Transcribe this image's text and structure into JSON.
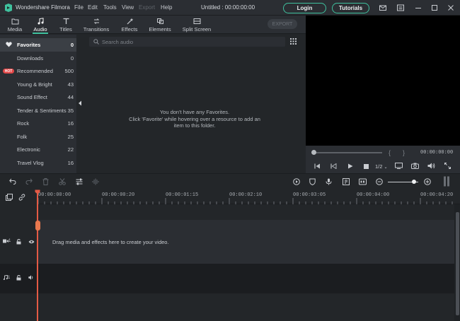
{
  "titlebar": {
    "app_name": "Wondershare Filmora",
    "menu": [
      "File",
      "Edit",
      "Tools",
      "View",
      "Export",
      "Help"
    ],
    "document_title": "Untitled : 00:00:00:00",
    "login_label": "Login",
    "tutorials_label": "Tutorials",
    "accent_color": "#3fc19e"
  },
  "tabs": [
    {
      "label": "Media",
      "icon": "folder-icon"
    },
    {
      "label": "Audio",
      "icon": "music-note-icon"
    },
    {
      "label": "Titles",
      "icon": "text-t-icon"
    },
    {
      "label": "Transitions",
      "icon": "transition-icon"
    },
    {
      "label": "Effects",
      "icon": "magic-wand-icon"
    },
    {
      "label": "Elements",
      "icon": "elements-icon"
    },
    {
      "label": "Split Screen",
      "icon": "split-screen-icon"
    }
  ],
  "export_label": "EXPORT",
  "categories": [
    {
      "name": "Favorites",
      "count": "0"
    },
    {
      "name": "Downloads",
      "count": "0"
    },
    {
      "name": "Recommended",
      "count": "500",
      "badge": "HOT"
    },
    {
      "name": "Young & Bright",
      "count": "43"
    },
    {
      "name": "Sound Effect",
      "count": "44"
    },
    {
      "name": "Tender & Sentiments",
      "count": "35"
    },
    {
      "name": "Rock",
      "count": "16"
    },
    {
      "name": "Folk",
      "count": "25"
    },
    {
      "name": "Electronic",
      "count": "22"
    },
    {
      "name": "Travel Vlog",
      "count": "16"
    }
  ],
  "search": {
    "placeholder": "Search audio"
  },
  "empty_message": {
    "line1": "You don't have any Favorites.",
    "line2": "Click 'Favorite' while hovering over a resource to add an",
    "line3": "item to this folder."
  },
  "preview": {
    "time": "00:00:00:00",
    "braces_left": "{",
    "braces_right": "}",
    "quality": "1/2"
  },
  "ruler_ticks": [
    "00:00:00:00",
    "00:00:00:20",
    "00:00:01:15",
    "00:00:02:10",
    "00:00:03:05",
    "00:00:04:00",
    "00:00:04:20"
  ],
  "timeline": {
    "drop_message": "Drag media and effects here to create your video.",
    "video_track_num": "1",
    "audio_track_num": "1"
  }
}
